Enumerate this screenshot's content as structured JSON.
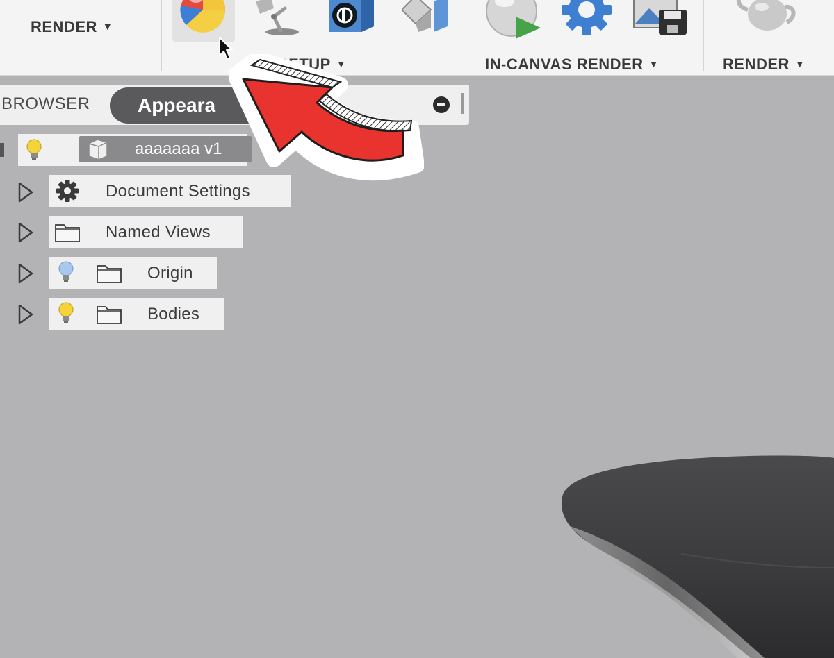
{
  "toolbar": {
    "render_menu_label": "RENDER",
    "setup_label": "SETUP",
    "in_canvas_render_label": "IN-CANVAS RENDER",
    "render_group_label": "RENDER",
    "icons": [
      "appearance-icon",
      "scene-settings-lamp-icon",
      "decal-icon",
      "texture-map-icon",
      "in-canvas-render-icon",
      "render-settings-gear-icon",
      "capture-image-icon",
      "render-teapot-icon"
    ]
  },
  "browser": {
    "tab_browser": "BROWSER",
    "tab_appearance": "Appeara",
    "root": {
      "name": "aaaaaaa v1"
    },
    "items": [
      {
        "label": "Document Settings",
        "icon": "gear-icon"
      },
      {
        "label": "Named Views",
        "icon": "folder-icon"
      },
      {
        "label": "Origin",
        "icon": "folder-icon",
        "visibility": "hidden"
      },
      {
        "label": "Bodies",
        "icon": "folder-icon",
        "visibility": "visible"
      }
    ]
  },
  "colors": {
    "canvas_bg": "#b3b2b4",
    "annotation_arrow": "#e8332e",
    "lightbulb_on": "#f5d33a",
    "lightbulb_off": "#a9c8ee"
  }
}
